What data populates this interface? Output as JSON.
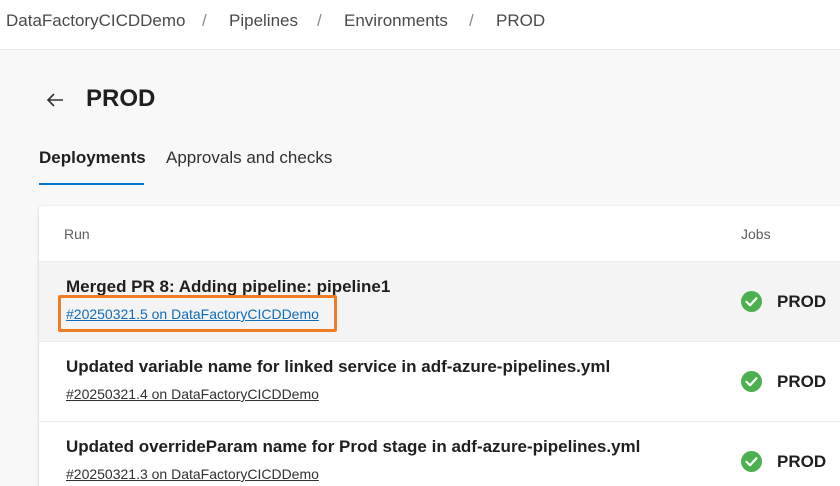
{
  "breadcrumb": [
    "DataFactoryCICDDemo",
    "Pipelines",
    "Environments",
    "PROD"
  ],
  "breadcrumb_separator": "/",
  "page": {
    "title": "PROD",
    "back_icon": "arrow-left-icon"
  },
  "tabs": [
    {
      "label": "Deployments",
      "active": true
    },
    {
      "label": "Approvals and checks",
      "active": false
    }
  ],
  "table": {
    "headers": {
      "run": "Run",
      "jobs": "Jobs"
    },
    "rows": [
      {
        "title": "Merged PR 8: Adding pipeline: pipeline1",
        "link": "#20250321.5 on DataFactoryCICDDemo",
        "job": "PROD",
        "status": "succeeded",
        "selected": true
      },
      {
        "title": "Updated variable name for linked service in adf-azure-pipelines.yml",
        "link": "#20250321.4 on DataFactoryCICDDemo",
        "job": "PROD",
        "status": "succeeded",
        "selected": false
      },
      {
        "title": "Updated overrideParam name for Prod stage in adf-azure-pipelines.yml",
        "link": "#20250321.3 on DataFactoryCICDDemo",
        "job": "PROD",
        "status": "succeeded",
        "selected": false
      }
    ]
  },
  "colors": {
    "accent": "#0078d4",
    "success": "#4caf50",
    "highlight": "#f07c23"
  }
}
